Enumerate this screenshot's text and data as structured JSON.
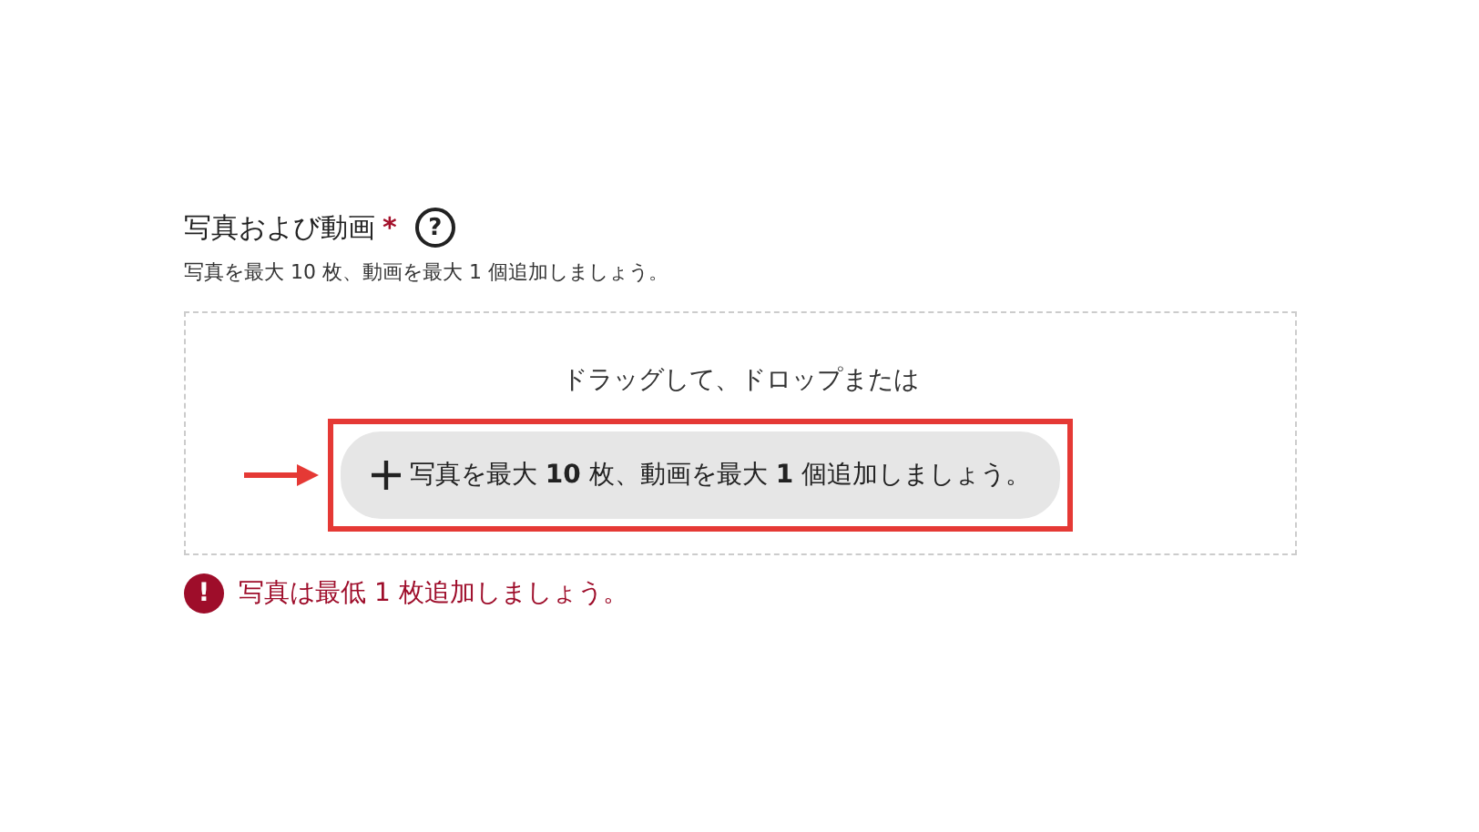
{
  "field": {
    "label": "写真および動画",
    "required_mark": "*",
    "help_icon": "?",
    "hint": "写真を最大 10 枚、動画を最大 1 個追加しましょう。"
  },
  "dropzone": {
    "instruction": "ドラッグして、ドロップまたは",
    "button": "写真を最大 **10** 枚、動画を最大 **1** 個追加しましょう。"
  },
  "error": {
    "icon": "!",
    "message": "写真は最低 1 枚追加しましょう。"
  }
}
